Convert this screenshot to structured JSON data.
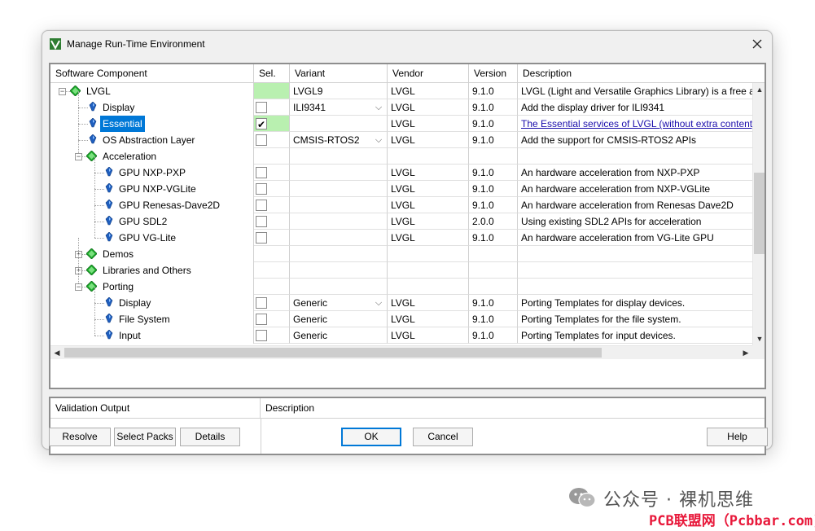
{
  "window": {
    "title": "Manage Run-Time Environment",
    "close_glyph": "✕"
  },
  "grid": {
    "columns": [
      "Software Component",
      "Sel.",
      "Variant",
      "Vendor",
      "Version",
      "Description"
    ],
    "rows": [
      {
        "component": "LVGL",
        "level": 0,
        "node": "group",
        "expand": "−",
        "sel": "",
        "sel_green": true,
        "checkbox": false,
        "checked": false,
        "variant": "LVGL9",
        "dropdown": false,
        "vendor": "LVGL",
        "version": "9.1.0",
        "description": "LVGL (Light and Versatile Graphics Library) is a free and",
        "link": false,
        "selected": false
      },
      {
        "component": "Display",
        "level": 1,
        "node": "leaf",
        "sel_green": false,
        "checkbox": true,
        "checked": false,
        "variant": "ILI9341",
        "dropdown": true,
        "vendor": "LVGL",
        "version": "9.1.0",
        "description": "Add the display driver for ILI9341",
        "link": false,
        "selected": false
      },
      {
        "component": "Essential",
        "level": 1,
        "node": "leaf",
        "sel_green": true,
        "checkbox": true,
        "checked": true,
        "variant": "",
        "dropdown": false,
        "vendor": "LVGL",
        "version": "9.1.0",
        "description": "The Essential services of LVGL (without extra content)",
        "link": true,
        "selected": true
      },
      {
        "component": "OS Abstraction Layer",
        "level": 1,
        "node": "leaf",
        "sel_green": false,
        "checkbox": true,
        "checked": false,
        "variant": "CMSIS-RTOS2",
        "dropdown": true,
        "vendor": "LVGL",
        "version": "9.1.0",
        "description": "Add the support for CMSIS-RTOS2 APIs",
        "link": false,
        "selected": false
      },
      {
        "component": "Acceleration",
        "level": 1,
        "node": "group",
        "expand": "−",
        "sel_green": false,
        "checkbox": false,
        "checked": false,
        "variant": "",
        "dropdown": false,
        "vendor": "",
        "version": "",
        "description": "",
        "link": false,
        "selected": false
      },
      {
        "component": "GPU NXP-PXP",
        "level": 2,
        "node": "leaf",
        "sel_green": false,
        "checkbox": true,
        "checked": false,
        "variant": "",
        "dropdown": false,
        "vendor": "LVGL",
        "version": "9.1.0",
        "description": "An hardware acceleration from NXP-PXP",
        "link": false,
        "selected": false
      },
      {
        "component": "GPU NXP-VGLite",
        "level": 2,
        "node": "leaf",
        "sel_green": false,
        "checkbox": true,
        "checked": false,
        "variant": "",
        "dropdown": false,
        "vendor": "LVGL",
        "version": "9.1.0",
        "description": "An hardware acceleration from NXP-VGLite",
        "link": false,
        "selected": false
      },
      {
        "component": "GPU Renesas-Dave2D",
        "level": 2,
        "node": "leaf",
        "sel_green": false,
        "checkbox": true,
        "checked": false,
        "variant": "",
        "dropdown": false,
        "vendor": "LVGL",
        "version": "9.1.0",
        "description": "An hardware acceleration from Renesas Dave2D",
        "link": false,
        "selected": false
      },
      {
        "component": "GPU SDL2",
        "level": 2,
        "node": "leaf",
        "sel_green": false,
        "checkbox": true,
        "checked": false,
        "variant": "",
        "dropdown": false,
        "vendor": "LVGL",
        "version": "2.0.0",
        "description": "Using existing SDL2 APIs for acceleration",
        "link": false,
        "selected": false
      },
      {
        "component": "GPU VG-Lite",
        "level": 2,
        "node": "leaf",
        "sel_green": false,
        "checkbox": true,
        "checked": false,
        "variant": "",
        "dropdown": false,
        "vendor": "LVGL",
        "version": "9.1.0",
        "description": "An hardware acceleration from VG-Lite GPU",
        "link": false,
        "selected": false
      },
      {
        "component": "Demos",
        "level": 1,
        "node": "group",
        "expand": "+",
        "sel_green": false,
        "checkbox": false,
        "checked": false,
        "variant": "",
        "dropdown": false,
        "vendor": "",
        "version": "",
        "description": "",
        "link": false,
        "selected": false
      },
      {
        "component": "Libraries and Others",
        "level": 1,
        "node": "group",
        "expand": "+",
        "sel_green": false,
        "checkbox": false,
        "checked": false,
        "variant": "",
        "dropdown": false,
        "vendor": "",
        "version": "",
        "description": "",
        "link": false,
        "selected": false
      },
      {
        "component": "Porting",
        "level": 1,
        "node": "group",
        "expand": "−",
        "sel_green": false,
        "checkbox": false,
        "checked": false,
        "variant": "",
        "dropdown": false,
        "vendor": "",
        "version": "",
        "description": "",
        "link": false,
        "selected": false
      },
      {
        "component": "Display",
        "level": 2,
        "node": "leaf",
        "sel_green": false,
        "checkbox": true,
        "checked": false,
        "variant": "Generic",
        "dropdown": true,
        "vendor": "LVGL",
        "version": "9.1.0",
        "description": "Porting Templates for display devices.",
        "link": false,
        "selected": false
      },
      {
        "component": "File System",
        "level": 2,
        "node": "leaf",
        "sel_green": false,
        "checkbox": true,
        "checked": false,
        "variant": "Generic",
        "dropdown": false,
        "vendor": "LVGL",
        "version": "9.1.0",
        "description": "Porting Templates for the file system.",
        "link": false,
        "selected": false
      },
      {
        "component": "Input",
        "level": 2,
        "node": "leaf",
        "sel_green": false,
        "checkbox": true,
        "checked": false,
        "variant": "Generic",
        "dropdown": false,
        "vendor": "LVGL",
        "version": "9.1.0",
        "description": "Porting Templates for input devices.",
        "link": false,
        "selected": false
      }
    ]
  },
  "validation": {
    "columns": [
      "Validation Output",
      "Description"
    ]
  },
  "buttons": {
    "resolve": "Resolve",
    "select_packs": "Select Packs",
    "details": "Details",
    "ok": "OK",
    "cancel": "Cancel",
    "help": "Help"
  },
  "watermark": {
    "line1": "公众号 · 裸机思维",
    "line2": "PCB联盟网（Pcbbar.com)"
  },
  "colors": {
    "selection": "#0078d7",
    "sel_green": "#b9f0b0",
    "gem_green": "#1fae2e",
    "link": "#1a0dab",
    "watermark_red": "#e8183a"
  }
}
